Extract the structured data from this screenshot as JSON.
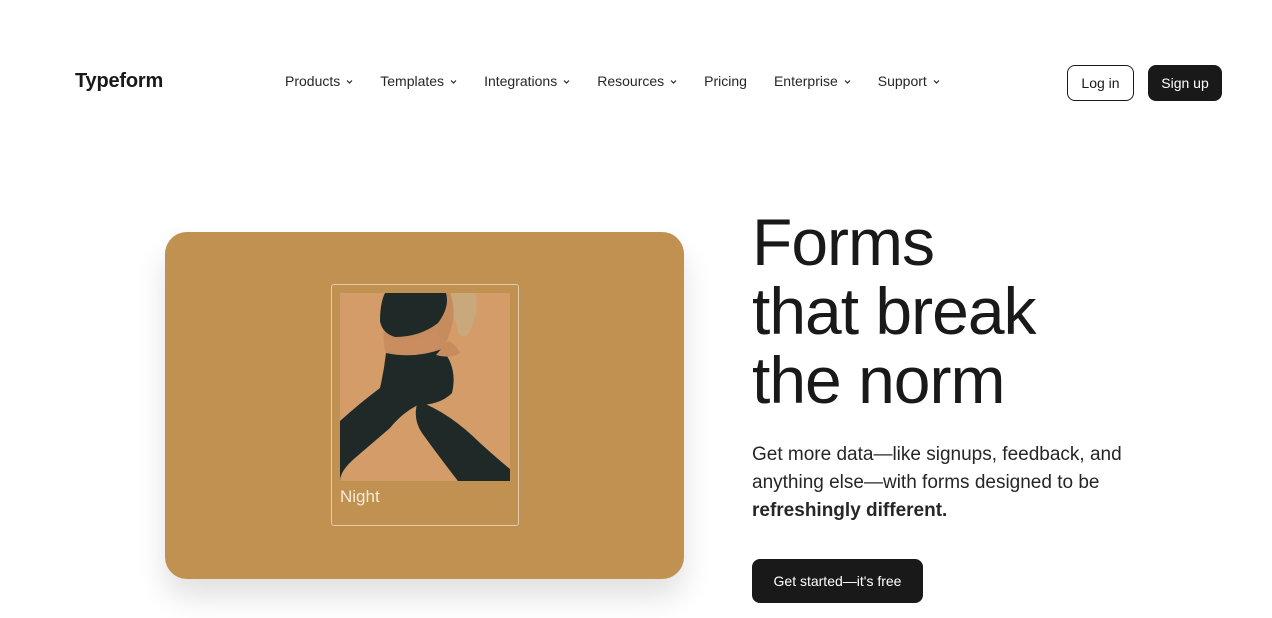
{
  "header": {
    "logo": "Typeform",
    "nav": [
      {
        "label": "Products",
        "has_dropdown": true
      },
      {
        "label": "Templates",
        "has_dropdown": true
      },
      {
        "label": "Integrations",
        "has_dropdown": true
      },
      {
        "label": "Resources",
        "has_dropdown": true
      },
      {
        "label": "Pricing",
        "has_dropdown": false
      },
      {
        "label": "Enterprise",
        "has_dropdown": true
      },
      {
        "label": "Support",
        "has_dropdown": true
      }
    ],
    "login_label": "Log in",
    "signup_label": "Sign up"
  },
  "hero": {
    "headline": [
      "Forms",
      "that break",
      "the norm"
    ],
    "subtext": "Get more data—like signups, feedback, and anything else—with forms designed to be",
    "subtext_bold": "refreshingly different.",
    "cta_label": "Get started—it's free",
    "card_caption": "Night"
  },
  "colors": {
    "card_bg": "#c09151",
    "photo_bg": "#d29a66",
    "text_dark": "#191919",
    "button_dark": "#191919"
  }
}
